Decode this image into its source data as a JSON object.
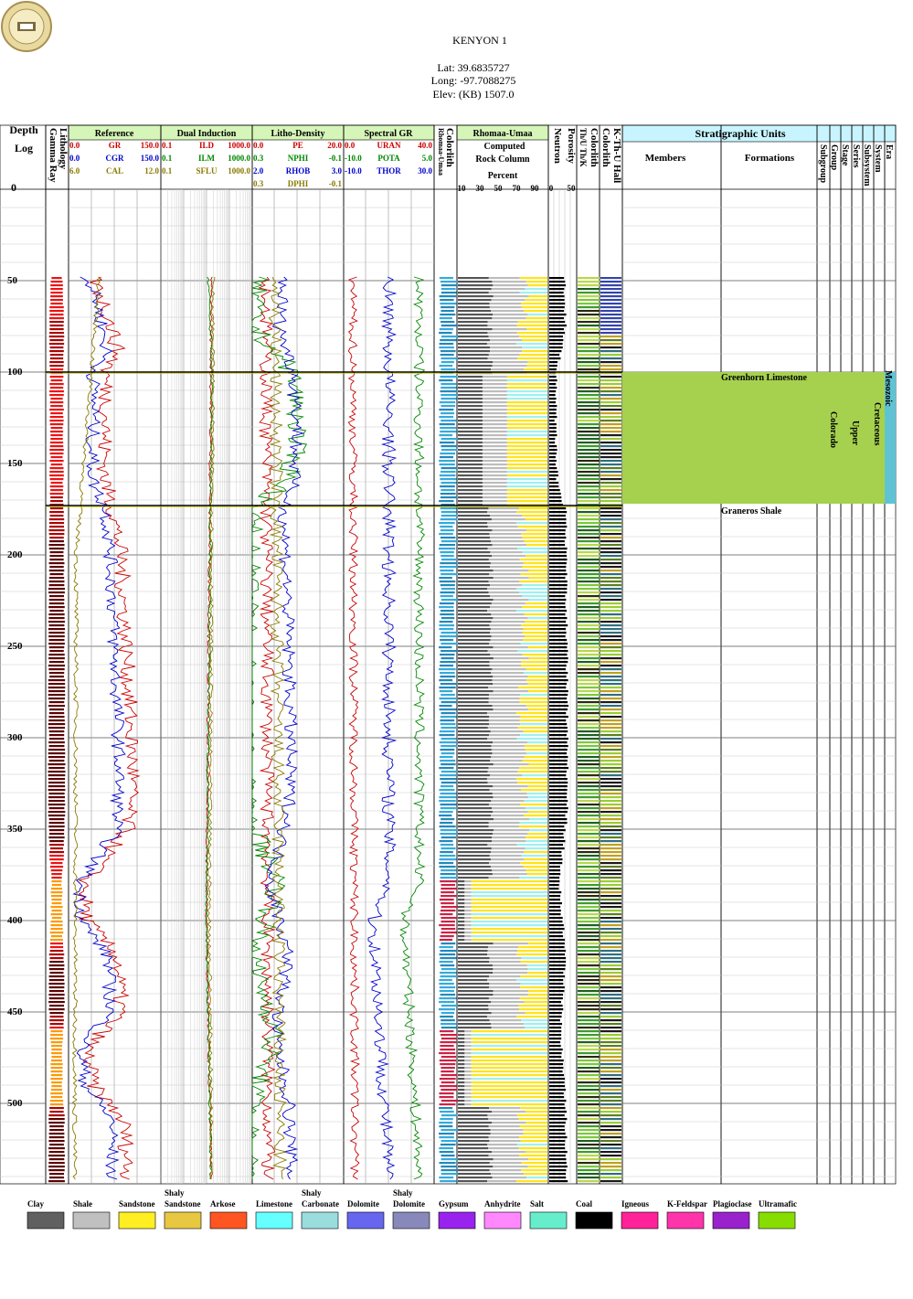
{
  "header": {
    "well_name": "KENYON 1",
    "lat": "Lat: 39.6835727",
    "long": "Long: -97.7088275",
    "elev": "Elev: (KB) 1507.0"
  },
  "depth_track": {
    "title": "Depth",
    "subtitle": "Log",
    "top_label": "0"
  },
  "tracks": {
    "lithology": "Lithology",
    "gamma_ray": "Gamma Ray",
    "reference": {
      "title": "Reference",
      "curves": [
        {
          "min": "0.0",
          "name": "GR",
          "max": "150.0",
          "color": "#cc0000"
        },
        {
          "min": "0.0",
          "name": "CGR",
          "max": "150.0",
          "color": "#0000cc"
        },
        {
          "min": "6.0",
          "name": "CAL",
          "max": "12.0",
          "color": "#8a7a00"
        }
      ]
    },
    "dual_induction": {
      "title": "Dual Induction",
      "curves": [
        {
          "min": "0.1",
          "name": "ILD",
          "max": "1000.0",
          "color": "#cc0000"
        },
        {
          "min": "0.1",
          "name": "ILM",
          "max": "1000.0",
          "color": "#008800"
        },
        {
          "min": "0.1",
          "name": "SFLU",
          "max": "1000.0",
          "color": "#8a7a00"
        }
      ]
    },
    "litho_density": {
      "title": "Litho-Density",
      "curves": [
        {
          "min": "0.0",
          "name": "PE",
          "max": "20.0",
          "color": "#cc0000"
        },
        {
          "min": "0.3",
          "name": "NPHI",
          "max": "-0.1",
          "color": "#008800"
        },
        {
          "min": "2.0",
          "name": "RHOB",
          "max": "3.0",
          "color": "#0000cc"
        },
        {
          "min": "0.3",
          "name": "DPHI",
          "max": "-0.1",
          "color": "#8a7a00"
        }
      ]
    },
    "spectral_gr": {
      "title": "Spectral GR",
      "curves": [
        {
          "min": "0.0",
          "name": "URAN",
          "max": "40.0",
          "color": "#cc0000"
        },
        {
          "min": "-10.0",
          "name": "POTA",
          "max": "5.0",
          "color": "#008800"
        },
        {
          "min": "-10.0",
          "name": "THOR",
          "max": "30.0",
          "color": "#0000cc"
        }
      ]
    },
    "colorlith": {
      "title": "Colorlith",
      "subtitle": "Rhomaa-Umaa"
    },
    "rock_column": {
      "title": "Rhomaa-Umaa",
      "line1": "Computed",
      "line2": "Rock Column",
      "line3": "Percent",
      "ticks": [
        "10",
        "30",
        "50",
        "70",
        "90"
      ]
    },
    "porosity": {
      "title": "Porosity",
      "subtitle": "Neutron",
      "ticks": [
        "0",
        "50"
      ]
    },
    "colorlith_thuk": {
      "title": "Colorlith",
      "subtitle": "Th/U Th/K"
    },
    "khall": {
      "title": "K-Th-U Hall",
      "subtitle": "Colorlith"
    },
    "strat": {
      "title": "Stratigraphic Units",
      "members": "Members",
      "formations": "Formations",
      "columns": [
        "Subgroup",
        "Group",
        "Stage",
        "Series",
        "Subsystem",
        "System",
        "Era"
      ]
    }
  },
  "depth_labels": [
    "50",
    "100",
    "150",
    "200",
    "250",
    "300",
    "350",
    "400",
    "450",
    "500"
  ],
  "formations": [
    {
      "name": "Greenhorn Limestone",
      "top": 100
    },
    {
      "name": "Graneros Shale",
      "top": 173
    }
  ],
  "strat_units": {
    "group": "Colorado",
    "series": "Upper",
    "system": "Cretaceous",
    "era": "Mesozoic"
  },
  "chart_data": {
    "type": "line",
    "title": "KENYON 1",
    "ylabel": "Depth",
    "ylim": [
      0,
      543
    ],
    "log_start_depth": 48,
    "series": [
      {
        "name": "GR",
        "units_range": [
          0,
          150
        ],
        "points": [
          [
            48,
            40
          ],
          [
            60,
            55
          ],
          [
            75,
            70
          ],
          [
            90,
            80
          ],
          [
            100,
            60
          ],
          [
            120,
            62
          ],
          [
            140,
            58
          ],
          [
            160,
            60
          ],
          [
            175,
            72
          ],
          [
            200,
            85
          ],
          [
            230,
            90
          ],
          [
            260,
            95
          ],
          [
            290,
            100
          ],
          [
            320,
            105
          ],
          [
            350,
            95
          ],
          [
            380,
            25
          ],
          [
            400,
            30
          ],
          [
            420,
            80
          ],
          [
            450,
            85
          ],
          [
            470,
            30
          ],
          [
            490,
            40
          ],
          [
            510,
            90
          ],
          [
            530,
            95
          ]
        ]
      },
      {
        "name": "CGR",
        "units_range": [
          0,
          150
        ],
        "points": [
          [
            48,
            30
          ],
          [
            60,
            45
          ],
          [
            75,
            55
          ],
          [
            90,
            62
          ],
          [
            100,
            40
          ],
          [
            120,
            42
          ],
          [
            140,
            38
          ],
          [
            160,
            40
          ],
          [
            175,
            60
          ],
          [
            200,
            68
          ],
          [
            230,
            72
          ],
          [
            260,
            75
          ],
          [
            290,
            80
          ],
          [
            320,
            82
          ],
          [
            350,
            78
          ],
          [
            380,
            18
          ],
          [
            400,
            22
          ],
          [
            420,
            65
          ],
          [
            450,
            68
          ],
          [
            470,
            20
          ],
          [
            490,
            28
          ],
          [
            510,
            72
          ],
          [
            530,
            70
          ]
        ]
      },
      {
        "name": "NPHI",
        "units_range": [
          0.3,
          -0.1
        ],
        "points": [
          [
            48,
            0.28
          ],
          [
            75,
            0.3
          ],
          [
            100,
            0.12
          ],
          [
            130,
            0.1
          ],
          [
            160,
            0.14
          ],
          [
            175,
            0.3
          ],
          [
            220,
            0.32
          ],
          [
            260,
            0.33
          ],
          [
            300,
            0.34
          ],
          [
            340,
            0.33
          ],
          [
            380,
            0.18
          ],
          [
            420,
            0.3
          ],
          [
            460,
            0.2
          ],
          [
            500,
            0.3
          ],
          [
            530,
            0.32
          ]
        ]
      },
      {
        "name": "RHOB",
        "units_range": [
          2.0,
          3.0
        ],
        "points": [
          [
            48,
            2.35
          ],
          [
            75,
            2.3
          ],
          [
            100,
            2.45
          ],
          [
            130,
            2.5
          ],
          [
            160,
            2.45
          ],
          [
            175,
            2.35
          ],
          [
            220,
            2.38
          ],
          [
            260,
            2.4
          ],
          [
            300,
            2.42
          ],
          [
            340,
            2.4
          ],
          [
            380,
            2.2
          ],
          [
            420,
            2.4
          ],
          [
            460,
            2.25
          ],
          [
            500,
            2.4
          ],
          [
            530,
            2.42
          ]
        ]
      }
    ]
  },
  "legend": [
    {
      "label": "Clay",
      "fill": "#606060"
    },
    {
      "label": "Shale",
      "fill": "#c0c0c0"
    },
    {
      "label": "Sandstone",
      "fill": "#ffee22"
    },
    {
      "label": "Shaly Sandstone",
      "fill": "#e8c840"
    },
    {
      "label": "Arkose",
      "fill": "#ff5522"
    },
    {
      "label": "Limestone",
      "fill": "#66ffff"
    },
    {
      "label": "Shaly Carbonate",
      "fill": "#99dddd"
    },
    {
      "label": "Dolomite",
      "fill": "#6666ee"
    },
    {
      "label": "Shaly Dolomite",
      "fill": "#8888bb"
    },
    {
      "label": "Gypsum",
      "fill": "#9922ee"
    },
    {
      "label": "Anhydrite",
      "fill": "#ff88ff"
    },
    {
      "label": "Salt",
      "fill": "#66eecc"
    },
    {
      "label": "Coal",
      "fill": "#000000"
    },
    {
      "label": "Igneous",
      "fill": "#ff2299"
    },
    {
      "label": "K-Feldspar",
      "fill": "#ff33aa"
    },
    {
      "label": "Plagioclase",
      "fill": "#9922cc"
    },
    {
      "label": "Ultramafic",
      "fill": "#88dd00"
    }
  ]
}
